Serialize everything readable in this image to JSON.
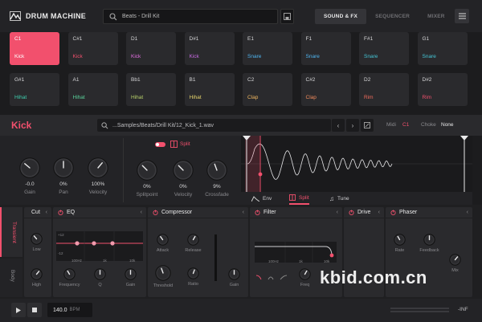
{
  "app": {
    "title": "DRUM MACHINE"
  },
  "header": {
    "preset": "Beats - Drill Kit",
    "tabs": [
      {
        "label": "SOUND & FX",
        "active": true
      },
      {
        "label": "SEQUENCER",
        "active": false
      },
      {
        "label": "MIXER",
        "active": false
      }
    ]
  },
  "pads": [
    {
      "note": "C1",
      "name": "Kick",
      "color": "#ffffff",
      "selected": true
    },
    {
      "note": "C#1",
      "name": "Kick",
      "color": "#f2506d"
    },
    {
      "note": "D1",
      "name": "Kick",
      "color": "#e16ee0"
    },
    {
      "note": "D#1",
      "name": "Kick",
      "color": "#c86be3"
    },
    {
      "note": "E1",
      "name": "Snare",
      "color": "#4fb5f0"
    },
    {
      "note": "F1",
      "name": "Snare",
      "color": "#4fb5f0"
    },
    {
      "note": "F#1",
      "name": "Snare",
      "color": "#45c6d6"
    },
    {
      "note": "G1",
      "name": "Snare",
      "color": "#45c6d6"
    },
    {
      "note": "G#1",
      "name": "Hihat",
      "color": "#3fd0b0"
    },
    {
      "note": "A1",
      "name": "Hihat",
      "color": "#5ad39b"
    },
    {
      "note": "Bb1",
      "name": "Hihat",
      "color": "#b9d26a"
    },
    {
      "note": "B1",
      "name": "Hihat",
      "color": "#e6d46b"
    },
    {
      "note": "C2",
      "name": "Clap",
      "color": "#f0b760"
    },
    {
      "note": "C#2",
      "name": "Clap",
      "color": "#f08a5c"
    },
    {
      "note": "D2",
      "name": "Rim",
      "color": "#f26c5c"
    },
    {
      "note": "D#2",
      "name": "Rim",
      "color": "#f2506d"
    }
  ],
  "instrument": {
    "name": "Kick",
    "path": "...Samples/Beats/Drill Kit/12_Kick_1.wav",
    "midi_label": "Midi",
    "midi_value": "C1",
    "choke_label": "Choke",
    "choke_value": "None",
    "split_label": "Split",
    "knobs": [
      {
        "value": "-0.0",
        "label": "Gain"
      },
      {
        "value": "0%",
        "label": "Pan"
      },
      {
        "value": "100%",
        "label": "Velocity"
      },
      {
        "value": "0%",
        "label": "Splitpoint"
      },
      {
        "value": "0%",
        "label": "Velocity"
      },
      {
        "value": "9%",
        "label": "Crossfade"
      }
    ]
  },
  "wave_tabs": [
    {
      "label": "Env",
      "active": false
    },
    {
      "label": "Split",
      "active": true
    },
    {
      "label": "Tune",
      "active": false
    }
  ],
  "side_tabs": [
    {
      "label": "Transient",
      "active": true
    },
    {
      "label": "Body",
      "active": false
    }
  ],
  "fx": {
    "cut": {
      "title": "Cut",
      "knobs": [
        "Low",
        "High"
      ]
    },
    "eq": {
      "title": "EQ",
      "graph": {
        "db_top": "+12",
        "db_bottom": "-12",
        "freqs": [
          "100Hz",
          "1k",
          "10k"
        ]
      },
      "knobs": [
        "Frequency",
        "Q",
        "Gain"
      ]
    },
    "compressor": {
      "title": "Compressor",
      "knobs": [
        "Attack",
        "Release",
        "Threshold",
        "Ratio",
        "Gain"
      ]
    },
    "filter": {
      "title": "Filter",
      "freqs": [
        "100Hz",
        "1k",
        "10k"
      ],
      "knobs": [
        "Freq"
      ]
    },
    "drive": {
      "title": "Drive"
    },
    "phaser": {
      "title": "Phaser",
      "knobs": [
        "Rate",
        "Feedback",
        "Mix"
      ]
    }
  },
  "transport": {
    "bpm": "140.0",
    "bpm_label": "BPM",
    "level": "-INF"
  },
  "watermark": "kbid.com.cn"
}
